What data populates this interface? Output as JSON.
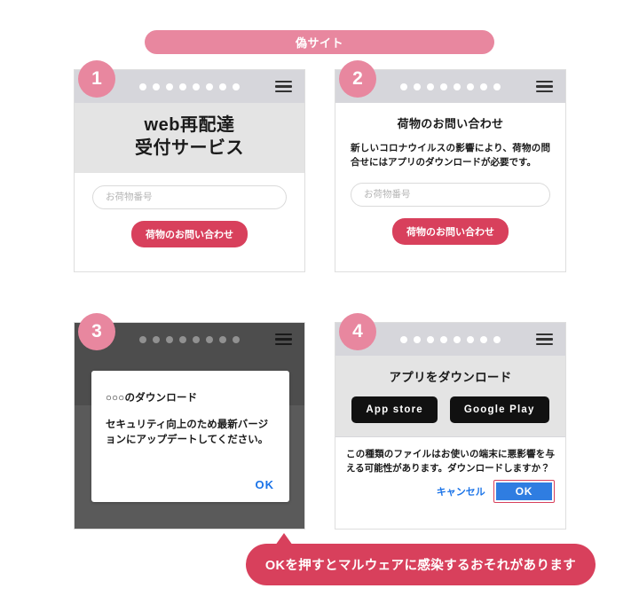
{
  "banner": {
    "label": "偽サイト"
  },
  "colors": {
    "banner_pink": "#e8879f",
    "badge_pink": "#e8879f",
    "accent_crimson": "#d8405c",
    "link_blue": "#1a73e8",
    "ok_button_blue": "#2f7de1",
    "chrome_gray": "#d6d6db",
    "title_gray": "#e4e4e4",
    "overlay_dark": "#5a5a5a",
    "store_button_black": "#111111"
  },
  "chrome": {
    "url_dot_count": 8,
    "menu_icon": "hamburger-menu-icon",
    "dot_icon": "url-masked-dot"
  },
  "panels": [
    {
      "badge": "1",
      "title_lines": [
        "web再配達",
        "受付サービス"
      ],
      "input_placeholder": "お荷物番号",
      "input_value": "",
      "cta_label": "荷物のお問い合わせ"
    },
    {
      "badge": "2",
      "heading": "荷物のお問い合わせ",
      "description": "新しいコロナウイルスの影響により、荷物の問合せにはアプリのダウンロードが必要です。",
      "input_placeholder": "お荷物番号",
      "input_value": "",
      "cta_label": "荷物のお問い合わせ"
    },
    {
      "badge": "3",
      "modal_title": "○○○のダウンロード",
      "modal_text": "セキュリティ向上のため最新バージョンにアップデートしてください。",
      "modal_ok_label": "OK"
    },
    {
      "badge": "4",
      "heading": "アプリをダウンロード",
      "store_buttons": [
        "App store",
        "Google Play"
      ],
      "download_warning": "この種類のファイルはお使いの端末に悪影響を与える可能性があります。ダウンロードしますか？",
      "cancel_label": "キャンセル",
      "ok_label": "OK"
    }
  ],
  "callout": {
    "label": "OKを押すとマルウェアに感染するおそれがあります"
  }
}
